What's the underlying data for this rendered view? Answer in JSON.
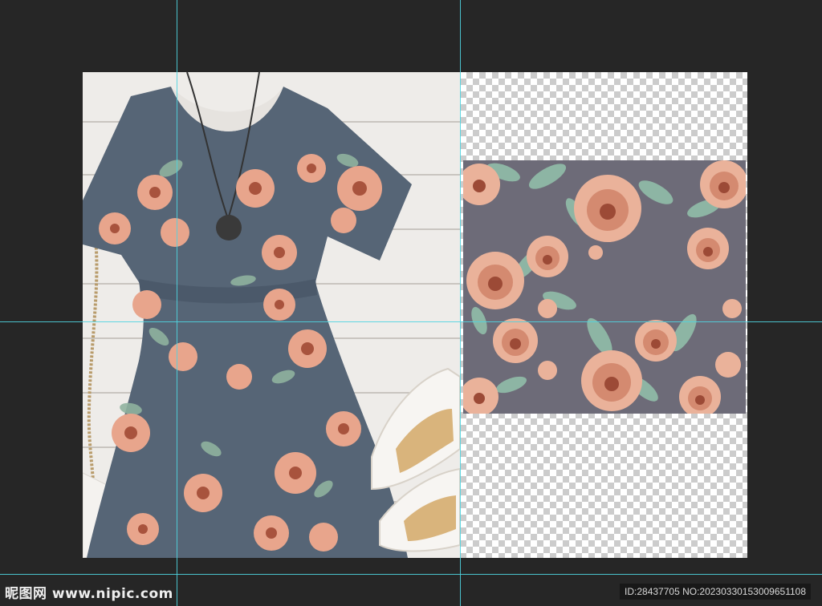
{
  "canvas": {
    "background_color": "#262626",
    "guide_color": "#4fd4e0",
    "left_image": "floral-dress-flat-lay-photo",
    "right_image": "floral-rose-pattern-on-transparent-layer"
  },
  "watermark": {
    "site": "昵图网 www.nipic.com",
    "id_text": "ID:28437705 NO:20230330153009651108"
  },
  "pattern": {
    "background": "#6d6b78",
    "rose_color": "#e8a58c",
    "rose_center": "#9c4a36",
    "leaf_color": "#8db5a4"
  }
}
